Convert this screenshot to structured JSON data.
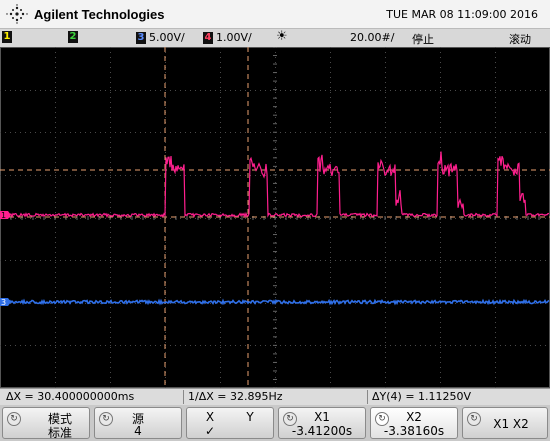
{
  "header": {
    "brand": "Agilent Technologies",
    "datetime": "TUE MAR 08 11:09:00 2016"
  },
  "status": {
    "ch1_num": "1",
    "ch2_num": "2",
    "ch3_num": "3",
    "ch3_scale": "5.00V/",
    "ch4_num": "4",
    "ch4_scale": "1.00V/",
    "trigger_symbol": "☀",
    "timebase": "20.00#/",
    "run_state": "停止",
    "mode": "滚动"
  },
  "markers": {
    "ch1": "1",
    "ch3": "3"
  },
  "measurements": {
    "delta_x": "ΔX = 30.400000000ms",
    "inv_delta_x": "1/ΔX = 32.895Hz",
    "delta_y": "ΔY(4) = 1.11250V"
  },
  "softkeys": {
    "mode_label_1": "模式",
    "mode_label_2": "标准",
    "source_label": "源",
    "source_value": "4",
    "x_label": "X",
    "y_label": "Y",
    "check": "✓",
    "x1_label": "X1",
    "x1_value": "-3.41200s",
    "x2_label": "X2",
    "x2_value": "-3.38160s",
    "x1x2_label": "X1 X2"
  },
  "colors": {
    "ch1": "#ff1f8e",
    "ch2": "#20c020",
    "ch3": "#2f6fe8",
    "ch4": "#ff3070",
    "ch1_box": "#ffe000",
    "screen": "#000000"
  }
}
